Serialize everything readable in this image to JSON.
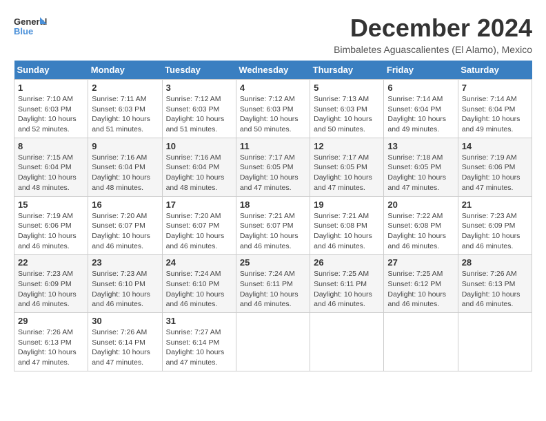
{
  "logo": {
    "line1": "General",
    "line2": "Blue"
  },
  "title": "December 2024",
  "subtitle": "Bimbaletes Aguascalientes (El Alamo), Mexico",
  "days_of_week": [
    "Sunday",
    "Monday",
    "Tuesday",
    "Wednesday",
    "Thursday",
    "Friday",
    "Saturday"
  ],
  "weeks": [
    [
      {
        "day": "1",
        "info": "Sunrise: 7:10 AM\nSunset: 6:03 PM\nDaylight: 10 hours\nand 52 minutes."
      },
      {
        "day": "2",
        "info": "Sunrise: 7:11 AM\nSunset: 6:03 PM\nDaylight: 10 hours\nand 51 minutes."
      },
      {
        "day": "3",
        "info": "Sunrise: 7:12 AM\nSunset: 6:03 PM\nDaylight: 10 hours\nand 51 minutes."
      },
      {
        "day": "4",
        "info": "Sunrise: 7:12 AM\nSunset: 6:03 PM\nDaylight: 10 hours\nand 50 minutes."
      },
      {
        "day": "5",
        "info": "Sunrise: 7:13 AM\nSunset: 6:03 PM\nDaylight: 10 hours\nand 50 minutes."
      },
      {
        "day": "6",
        "info": "Sunrise: 7:14 AM\nSunset: 6:04 PM\nDaylight: 10 hours\nand 49 minutes."
      },
      {
        "day": "7",
        "info": "Sunrise: 7:14 AM\nSunset: 6:04 PM\nDaylight: 10 hours\nand 49 minutes."
      }
    ],
    [
      {
        "day": "8",
        "info": "Sunrise: 7:15 AM\nSunset: 6:04 PM\nDaylight: 10 hours\nand 48 minutes."
      },
      {
        "day": "9",
        "info": "Sunrise: 7:16 AM\nSunset: 6:04 PM\nDaylight: 10 hours\nand 48 minutes."
      },
      {
        "day": "10",
        "info": "Sunrise: 7:16 AM\nSunset: 6:04 PM\nDaylight: 10 hours\nand 48 minutes."
      },
      {
        "day": "11",
        "info": "Sunrise: 7:17 AM\nSunset: 6:05 PM\nDaylight: 10 hours\nand 47 minutes."
      },
      {
        "day": "12",
        "info": "Sunrise: 7:17 AM\nSunset: 6:05 PM\nDaylight: 10 hours\nand 47 minutes."
      },
      {
        "day": "13",
        "info": "Sunrise: 7:18 AM\nSunset: 6:05 PM\nDaylight: 10 hours\nand 47 minutes."
      },
      {
        "day": "14",
        "info": "Sunrise: 7:19 AM\nSunset: 6:06 PM\nDaylight: 10 hours\nand 47 minutes."
      }
    ],
    [
      {
        "day": "15",
        "info": "Sunrise: 7:19 AM\nSunset: 6:06 PM\nDaylight: 10 hours\nand 46 minutes."
      },
      {
        "day": "16",
        "info": "Sunrise: 7:20 AM\nSunset: 6:07 PM\nDaylight: 10 hours\nand 46 minutes."
      },
      {
        "day": "17",
        "info": "Sunrise: 7:20 AM\nSunset: 6:07 PM\nDaylight: 10 hours\nand 46 minutes."
      },
      {
        "day": "18",
        "info": "Sunrise: 7:21 AM\nSunset: 6:07 PM\nDaylight: 10 hours\nand 46 minutes."
      },
      {
        "day": "19",
        "info": "Sunrise: 7:21 AM\nSunset: 6:08 PM\nDaylight: 10 hours\nand 46 minutes."
      },
      {
        "day": "20",
        "info": "Sunrise: 7:22 AM\nSunset: 6:08 PM\nDaylight: 10 hours\nand 46 minutes."
      },
      {
        "day": "21",
        "info": "Sunrise: 7:23 AM\nSunset: 6:09 PM\nDaylight: 10 hours\nand 46 minutes."
      }
    ],
    [
      {
        "day": "22",
        "info": "Sunrise: 7:23 AM\nSunset: 6:09 PM\nDaylight: 10 hours\nand 46 minutes."
      },
      {
        "day": "23",
        "info": "Sunrise: 7:23 AM\nSunset: 6:10 PM\nDaylight: 10 hours\nand 46 minutes."
      },
      {
        "day": "24",
        "info": "Sunrise: 7:24 AM\nSunset: 6:10 PM\nDaylight: 10 hours\nand 46 minutes."
      },
      {
        "day": "25",
        "info": "Sunrise: 7:24 AM\nSunset: 6:11 PM\nDaylight: 10 hours\nand 46 minutes."
      },
      {
        "day": "26",
        "info": "Sunrise: 7:25 AM\nSunset: 6:11 PM\nDaylight: 10 hours\nand 46 minutes."
      },
      {
        "day": "27",
        "info": "Sunrise: 7:25 AM\nSunset: 6:12 PM\nDaylight: 10 hours\nand 46 minutes."
      },
      {
        "day": "28",
        "info": "Sunrise: 7:26 AM\nSunset: 6:13 PM\nDaylight: 10 hours\nand 46 minutes."
      }
    ],
    [
      {
        "day": "29",
        "info": "Sunrise: 7:26 AM\nSunset: 6:13 PM\nDaylight: 10 hours\nand 47 minutes."
      },
      {
        "day": "30",
        "info": "Sunrise: 7:26 AM\nSunset: 6:14 PM\nDaylight: 10 hours\nand 47 minutes."
      },
      {
        "day": "31",
        "info": "Sunrise: 7:27 AM\nSunset: 6:14 PM\nDaylight: 10 hours\nand 47 minutes."
      },
      {
        "day": "",
        "info": ""
      },
      {
        "day": "",
        "info": ""
      },
      {
        "day": "",
        "info": ""
      },
      {
        "day": "",
        "info": ""
      }
    ]
  ]
}
